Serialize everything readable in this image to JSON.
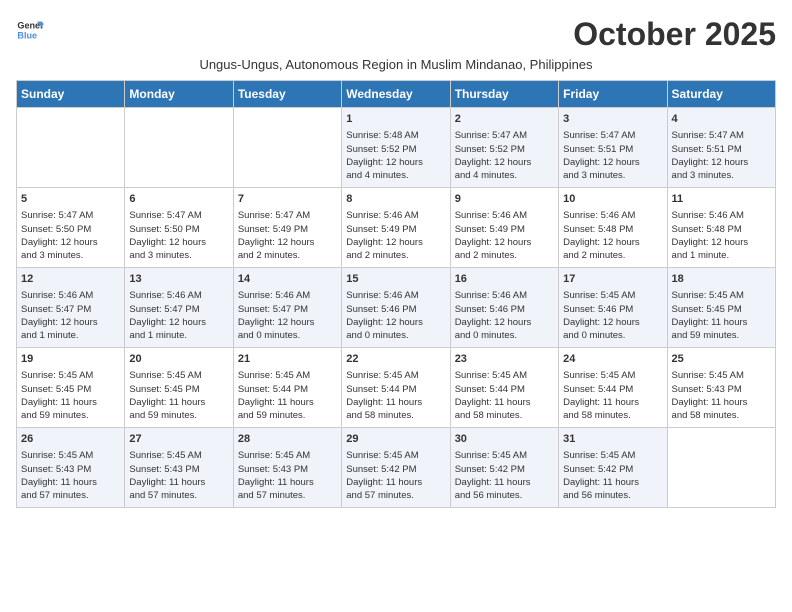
{
  "logo": {
    "line1": "General",
    "line2": "Blue"
  },
  "title": "October 2025",
  "subtitle": "Ungus-Ungus, Autonomous Region in Muslim Mindanao, Philippines",
  "days_header": [
    "Sunday",
    "Monday",
    "Tuesday",
    "Wednesday",
    "Thursday",
    "Friday",
    "Saturday"
  ],
  "weeks": [
    [
      {
        "day": "",
        "info": ""
      },
      {
        "day": "",
        "info": ""
      },
      {
        "day": "",
        "info": ""
      },
      {
        "day": "1",
        "info": "Sunrise: 5:48 AM\nSunset: 5:52 PM\nDaylight: 12 hours\nand 4 minutes."
      },
      {
        "day": "2",
        "info": "Sunrise: 5:47 AM\nSunset: 5:52 PM\nDaylight: 12 hours\nand 4 minutes."
      },
      {
        "day": "3",
        "info": "Sunrise: 5:47 AM\nSunset: 5:51 PM\nDaylight: 12 hours\nand 3 minutes."
      },
      {
        "day": "4",
        "info": "Sunrise: 5:47 AM\nSunset: 5:51 PM\nDaylight: 12 hours\nand 3 minutes."
      }
    ],
    [
      {
        "day": "5",
        "info": "Sunrise: 5:47 AM\nSunset: 5:50 PM\nDaylight: 12 hours\nand 3 minutes."
      },
      {
        "day": "6",
        "info": "Sunrise: 5:47 AM\nSunset: 5:50 PM\nDaylight: 12 hours\nand 3 minutes."
      },
      {
        "day": "7",
        "info": "Sunrise: 5:47 AM\nSunset: 5:49 PM\nDaylight: 12 hours\nand 2 minutes."
      },
      {
        "day": "8",
        "info": "Sunrise: 5:46 AM\nSunset: 5:49 PM\nDaylight: 12 hours\nand 2 minutes."
      },
      {
        "day": "9",
        "info": "Sunrise: 5:46 AM\nSunset: 5:49 PM\nDaylight: 12 hours\nand 2 minutes."
      },
      {
        "day": "10",
        "info": "Sunrise: 5:46 AM\nSunset: 5:48 PM\nDaylight: 12 hours\nand 2 minutes."
      },
      {
        "day": "11",
        "info": "Sunrise: 5:46 AM\nSunset: 5:48 PM\nDaylight: 12 hours\nand 1 minute."
      }
    ],
    [
      {
        "day": "12",
        "info": "Sunrise: 5:46 AM\nSunset: 5:47 PM\nDaylight: 12 hours\nand 1 minute."
      },
      {
        "day": "13",
        "info": "Sunrise: 5:46 AM\nSunset: 5:47 PM\nDaylight: 12 hours\nand 1 minute."
      },
      {
        "day": "14",
        "info": "Sunrise: 5:46 AM\nSunset: 5:47 PM\nDaylight: 12 hours\nand 0 minutes."
      },
      {
        "day": "15",
        "info": "Sunrise: 5:46 AM\nSunset: 5:46 PM\nDaylight: 12 hours\nand 0 minutes."
      },
      {
        "day": "16",
        "info": "Sunrise: 5:46 AM\nSunset: 5:46 PM\nDaylight: 12 hours\nand 0 minutes."
      },
      {
        "day": "17",
        "info": "Sunrise: 5:45 AM\nSunset: 5:46 PM\nDaylight: 12 hours\nand 0 minutes."
      },
      {
        "day": "18",
        "info": "Sunrise: 5:45 AM\nSunset: 5:45 PM\nDaylight: 11 hours\nand 59 minutes."
      }
    ],
    [
      {
        "day": "19",
        "info": "Sunrise: 5:45 AM\nSunset: 5:45 PM\nDaylight: 11 hours\nand 59 minutes."
      },
      {
        "day": "20",
        "info": "Sunrise: 5:45 AM\nSunset: 5:45 PM\nDaylight: 11 hours\nand 59 minutes."
      },
      {
        "day": "21",
        "info": "Sunrise: 5:45 AM\nSunset: 5:44 PM\nDaylight: 11 hours\nand 59 minutes."
      },
      {
        "day": "22",
        "info": "Sunrise: 5:45 AM\nSunset: 5:44 PM\nDaylight: 11 hours\nand 58 minutes."
      },
      {
        "day": "23",
        "info": "Sunrise: 5:45 AM\nSunset: 5:44 PM\nDaylight: 11 hours\nand 58 minutes."
      },
      {
        "day": "24",
        "info": "Sunrise: 5:45 AM\nSunset: 5:44 PM\nDaylight: 11 hours\nand 58 minutes."
      },
      {
        "day": "25",
        "info": "Sunrise: 5:45 AM\nSunset: 5:43 PM\nDaylight: 11 hours\nand 58 minutes."
      }
    ],
    [
      {
        "day": "26",
        "info": "Sunrise: 5:45 AM\nSunset: 5:43 PM\nDaylight: 11 hours\nand 57 minutes."
      },
      {
        "day": "27",
        "info": "Sunrise: 5:45 AM\nSunset: 5:43 PM\nDaylight: 11 hours\nand 57 minutes."
      },
      {
        "day": "28",
        "info": "Sunrise: 5:45 AM\nSunset: 5:43 PM\nDaylight: 11 hours\nand 57 minutes."
      },
      {
        "day": "29",
        "info": "Sunrise: 5:45 AM\nSunset: 5:42 PM\nDaylight: 11 hours\nand 57 minutes."
      },
      {
        "day": "30",
        "info": "Sunrise: 5:45 AM\nSunset: 5:42 PM\nDaylight: 11 hours\nand 56 minutes."
      },
      {
        "day": "31",
        "info": "Sunrise: 5:45 AM\nSunset: 5:42 PM\nDaylight: 11 hours\nand 56 minutes."
      },
      {
        "day": "",
        "info": ""
      }
    ]
  ]
}
